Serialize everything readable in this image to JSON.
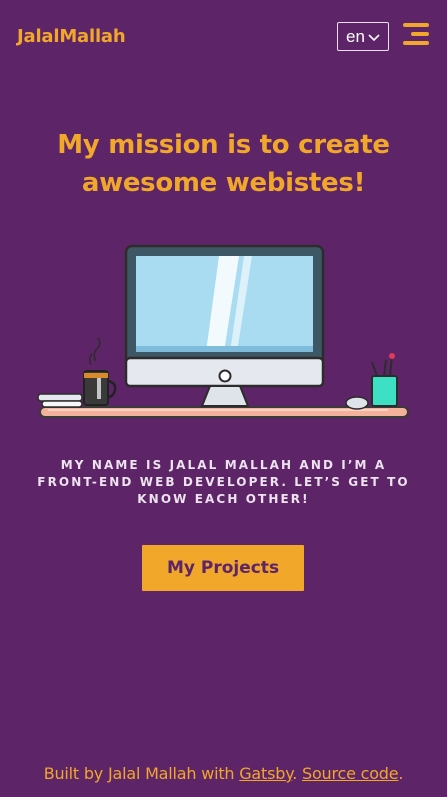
{
  "header": {
    "brand": "JalalMallah",
    "language": {
      "selected": "en"
    },
    "menu_icon": "hamburger-menu-icon"
  },
  "hero": {
    "title_line1": "My mission is to create",
    "title_line2": "awesome webistes!",
    "illustration": "desk-computer-illustration",
    "intro_line1": "My name is Jalal Mallah and I’m a",
    "intro_line2": "front-end web developer. Let’s get to",
    "intro_line3": "know each other!",
    "cta_label": "My Projects"
  },
  "footer": {
    "prefix": "Built by Jalal Mallah with ",
    "link1": "Gatsby",
    "separator": ". ",
    "link2": "Source code",
    "suffix": "."
  },
  "colors": {
    "background": "#5e2468",
    "accent": "#f0a72a",
    "text_light": "#ece3ee"
  }
}
